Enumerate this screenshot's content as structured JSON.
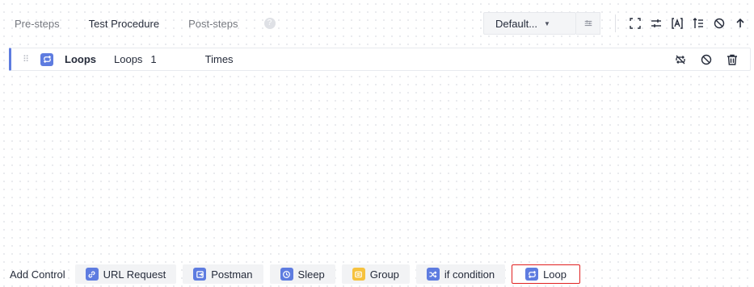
{
  "tabs": [
    "Pre-steps",
    "Test Procedure",
    "Post-steps"
  ],
  "active_tab": "Test Procedure",
  "help_icon": "?",
  "select": {
    "value": "Default...",
    "arrow": "▼"
  },
  "toolbar_icons": [
    "fullscreen-icon",
    "sliders-icon",
    "text-box-icon",
    "sort-icon",
    "disable-icon"
  ],
  "step": {
    "name": "Loops",
    "loops_label": "Loops",
    "loops_count": "1",
    "times_label": "Times",
    "actions": [
      "no-loop-icon",
      "disable-icon",
      "delete-icon"
    ]
  },
  "add_control": {
    "label": "Add Control",
    "buttons": [
      {
        "label": "URL Request",
        "icon": "link-icon",
        "color": "#5e7ce0"
      },
      {
        "label": "Postman",
        "icon": "postman-icon",
        "color": "#5e7ce0"
      },
      {
        "label": "Sleep",
        "icon": "clock-icon",
        "color": "#5e7ce0"
      },
      {
        "label": "Group",
        "icon": "group-icon",
        "color": "#f6c23e"
      },
      {
        "label": "if condition",
        "icon": "branch-icon",
        "color": "#5e7ce0"
      },
      {
        "label": "Loop",
        "icon": "loop-icon",
        "color": "#5e7ce0"
      }
    ]
  },
  "colors": {
    "accent": "#5e7ce0",
    "highlight_border": "#e02020",
    "group": "#f6c23e"
  }
}
